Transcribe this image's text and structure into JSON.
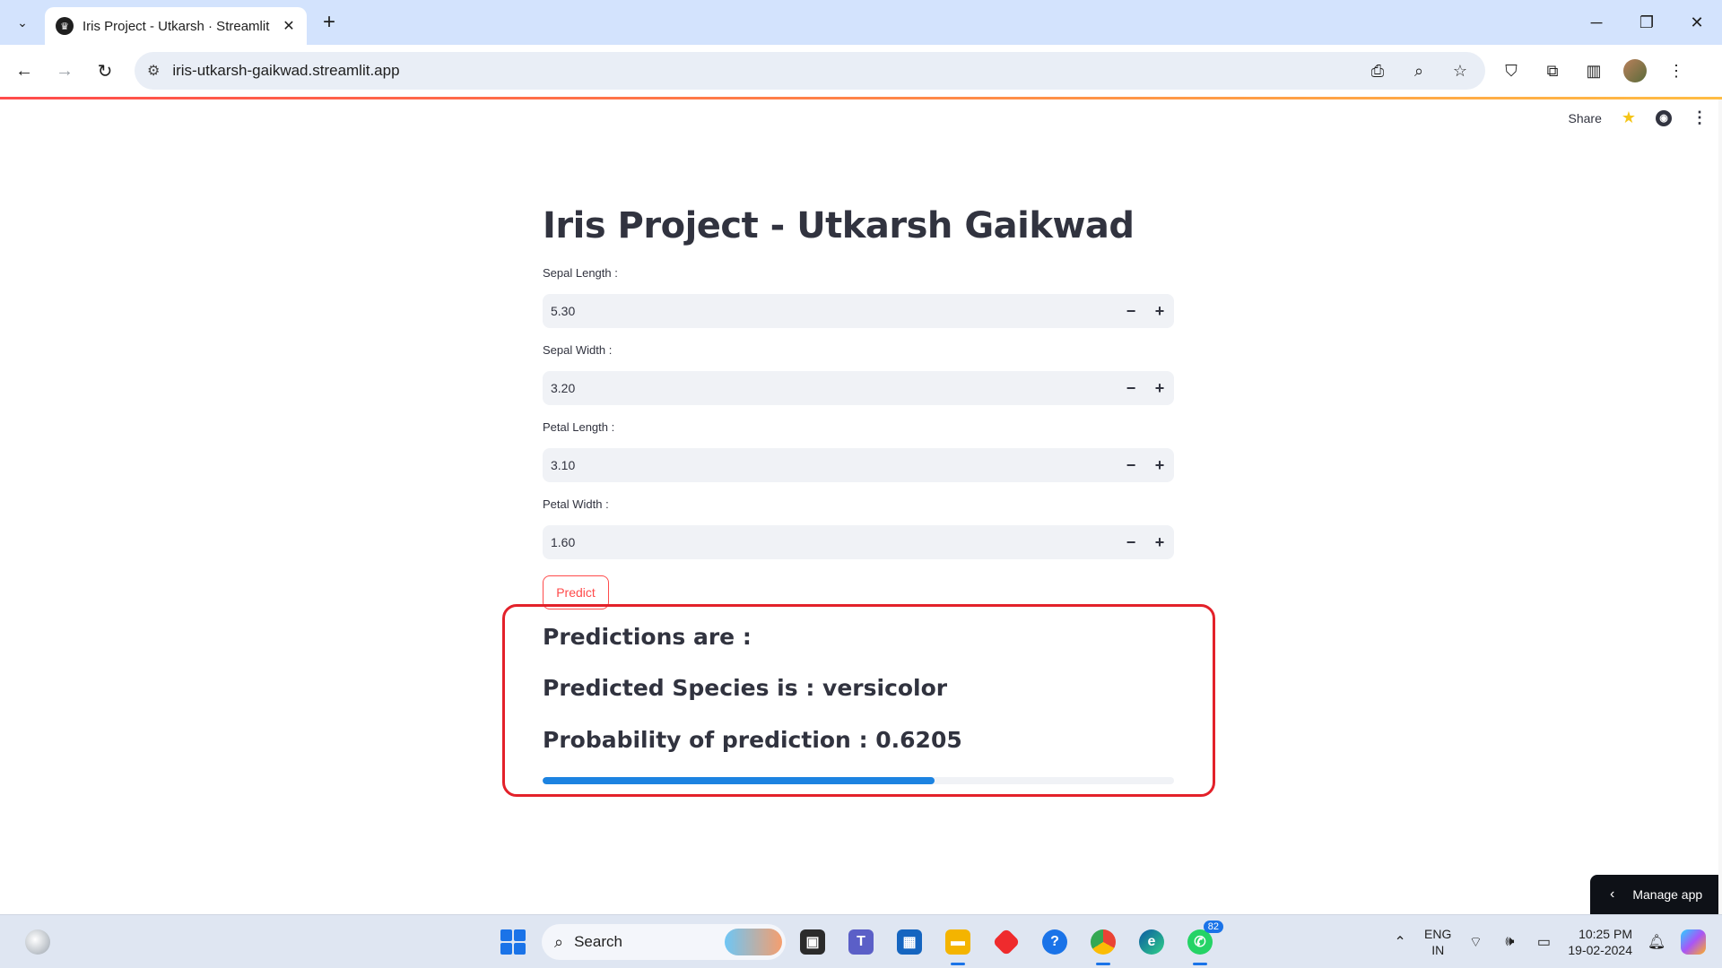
{
  "browser": {
    "tab_title": "Iris Project - Utkarsh · Streamlit",
    "url": "iris-utkarsh-gaikwad.streamlit.app"
  },
  "app_header": {
    "share_label": "Share"
  },
  "main": {
    "title": "Iris Project - Utkarsh Gaikwad",
    "fields": [
      {
        "label": "Sepal Length :",
        "value": "5.30"
      },
      {
        "label": "Sepal Width :",
        "value": "3.20"
      },
      {
        "label": "Petal Length :",
        "value": "3.10"
      },
      {
        "label": "Petal Width :",
        "value": "1.60"
      }
    ],
    "predict_label": "Predict"
  },
  "results": {
    "heading": "Predictions are :",
    "species_line": "Predicted Species is : versicolor",
    "probability_line": "Probability of prediction : 0.6205",
    "probability": 0.6205
  },
  "manage_app_label": "Manage app",
  "taskbar": {
    "search_label": "Search",
    "whatsapp_badge": "82",
    "lang_primary": "ENG",
    "lang_secondary": "IN",
    "time": "10:25 PM",
    "date": "19-02-2024"
  },
  "colors": {
    "accent": "#ff4b4b",
    "progress": "#1c83e1",
    "highlight_border": "#e3212a"
  }
}
